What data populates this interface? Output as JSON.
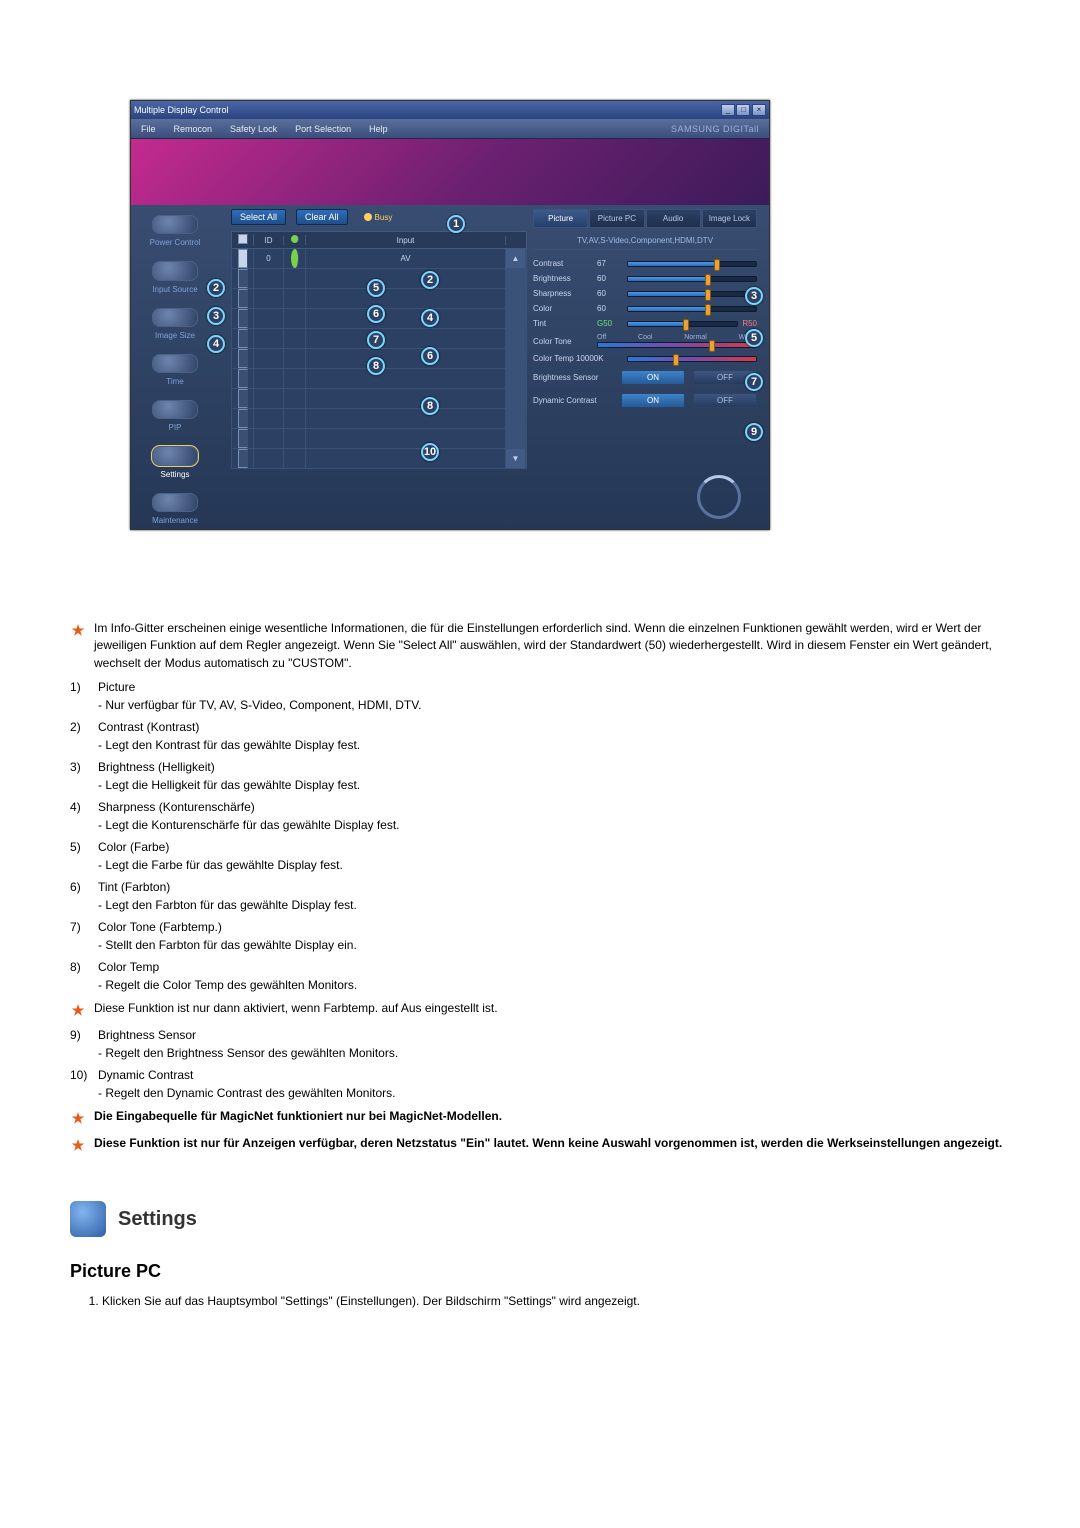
{
  "window": {
    "title": "Multiple Display Control",
    "menubar": [
      "File",
      "Remocon",
      "Safety Lock",
      "Port Selection",
      "Help"
    ],
    "brand": "SAMSUNG DIGITall",
    "window_controls": {
      "min": "_",
      "max": "□",
      "close": "×"
    },
    "sidebar": [
      {
        "label": "Power Control",
        "active": false
      },
      {
        "label": "Input Source",
        "active": false
      },
      {
        "label": "Image Size",
        "active": false
      },
      {
        "label": "Time",
        "active": false
      },
      {
        "label": "PIP",
        "active": false
      },
      {
        "label": "Settings",
        "active": true
      },
      {
        "label": "Maintenance",
        "active": false
      }
    ],
    "grid": {
      "select_all": "Select All",
      "clear_all": "Clear All",
      "busy": "Busy",
      "head": {
        "chk": "✓",
        "id": "ID",
        "dot": "",
        "input": "Input"
      },
      "row0": {
        "id": "0",
        "input": "AV",
        "chk": true,
        "green": true
      },
      "blank_rows": 10
    },
    "adjust": {
      "tabs": [
        {
          "label": "Picture",
          "active": true
        },
        {
          "label": "Picture PC",
          "active": false
        },
        {
          "label": "Audio",
          "active": false
        },
        {
          "label": "Image Lock",
          "active": false
        }
      ],
      "sources": "TV,AV,S-Video,Component,HDMI,DTV",
      "rows": {
        "contrast": {
          "label": "Contrast",
          "value": "67",
          "pct": 67
        },
        "brightness": {
          "label": "Brightness",
          "value": "60",
          "pct": 60
        },
        "sharpness": {
          "label": "Sharpness",
          "value": "60",
          "pct": 60
        },
        "color": {
          "label": "Color",
          "value": "60",
          "pct": 60
        }
      },
      "tint": {
        "label": "Tint",
        "left": "G50",
        "right": "R50",
        "pct": 50
      },
      "color_tone": {
        "label": "Color Tone",
        "opts": [
          "Off",
          "Cool",
          "Normal",
          "Warm"
        ],
        "pct": 70
      },
      "color_temp": {
        "label": "Color Temp 10000K",
        "pct": 35
      },
      "brightness_sensor": {
        "label": "Brightness Sensor",
        "on": "ON",
        "off": "OFF"
      },
      "dynamic_contrast": {
        "label": "Dynamic Contrast",
        "on": "ON",
        "off": "OFF"
      }
    },
    "circles": {
      "c1": "1",
      "c2_l": "2",
      "c2_r": "2",
      "c3_l": "3",
      "c3_r": "3",
      "c4_l": "4",
      "c4_r": "4",
      "c5_l": "5",
      "c5_r": "5",
      "c6_l": "6",
      "c6_r": "6",
      "c7_l": "7",
      "c7_r": "7",
      "c8_l": "8",
      "c8_r": "8",
      "c9": "9",
      "c10": "10"
    }
  },
  "intro_star": "Im Info-Gitter erscheinen einige wesentliche Informationen, die für die Einstellungen erforderlich sind. Wenn die einzelnen Funktionen gewählt werden, wird er Wert der jeweiligen Funktion auf dem Regler angezeigt. Wenn Sie \"Select All\" auswählen, wird der Standardwert (50) wiederhergestellt. Wird in diesem Fenster ein Wert geändert, wechselt der Modus automatisch zu \"CUSTOM\".",
  "defs": [
    {
      "t": "Picture",
      "d": "- Nur verfügbar für TV, AV, S-Video, Component, HDMI, DTV."
    },
    {
      "t": "Contrast (Kontrast)",
      "d": "- Legt den Kontrast für das gewählte Display fest."
    },
    {
      "t": "Brightness (Helligkeit)",
      "d": "- Legt die Helligkeit für das gewählte Display fest."
    },
    {
      "t": "Sharpness (Konturenschärfe)",
      "d": "- Legt die Konturenschärfe für das gewählte Display fest."
    },
    {
      "t": "Color (Farbe)",
      "d": "- Legt die Farbe für das gewählte Display fest."
    },
    {
      "t": "Tint (Farbton)",
      "d": "- Legt den Farbton für das gewählte Display fest."
    },
    {
      "t": "Color Tone (Farbtemp.)",
      "d": "- Stellt den Farbton für das gewählte Display ein."
    },
    {
      "t": "Color Temp",
      "d": "- Regelt die Color Temp des gewählten Monitors."
    }
  ],
  "star_after_8": "Diese Funktion ist nur dann aktiviert, wenn Farbtemp. auf Aus eingestellt ist.",
  "defs2": [
    {
      "n": "9",
      "t": "Brightness Sensor",
      "d": "- Regelt den Brightness Sensor des gewählten Monitors."
    },
    {
      "n": "10",
      "t": "Dynamic Contrast",
      "d": "- Regelt den Dynamic Contrast des gewählten Monitors."
    }
  ],
  "star_note_1": "Die Eingabequelle für MagicNet funktioniert nur bei MagicNet-Modellen.",
  "star_note_2": "Diese Funktion ist nur für Anzeigen verfügbar, deren Netzstatus \"Ein\" lautet. Wenn keine Auswahl vorgenommen ist, werden die Werkseinstellungen angezeigt.",
  "section_title": "Settings",
  "subhead": "Picture PC",
  "step1": "Klicken Sie auf das Hauptsymbol \"Settings\" (Einstellungen). Der Bildschirm \"Settings\" wird angezeigt."
}
